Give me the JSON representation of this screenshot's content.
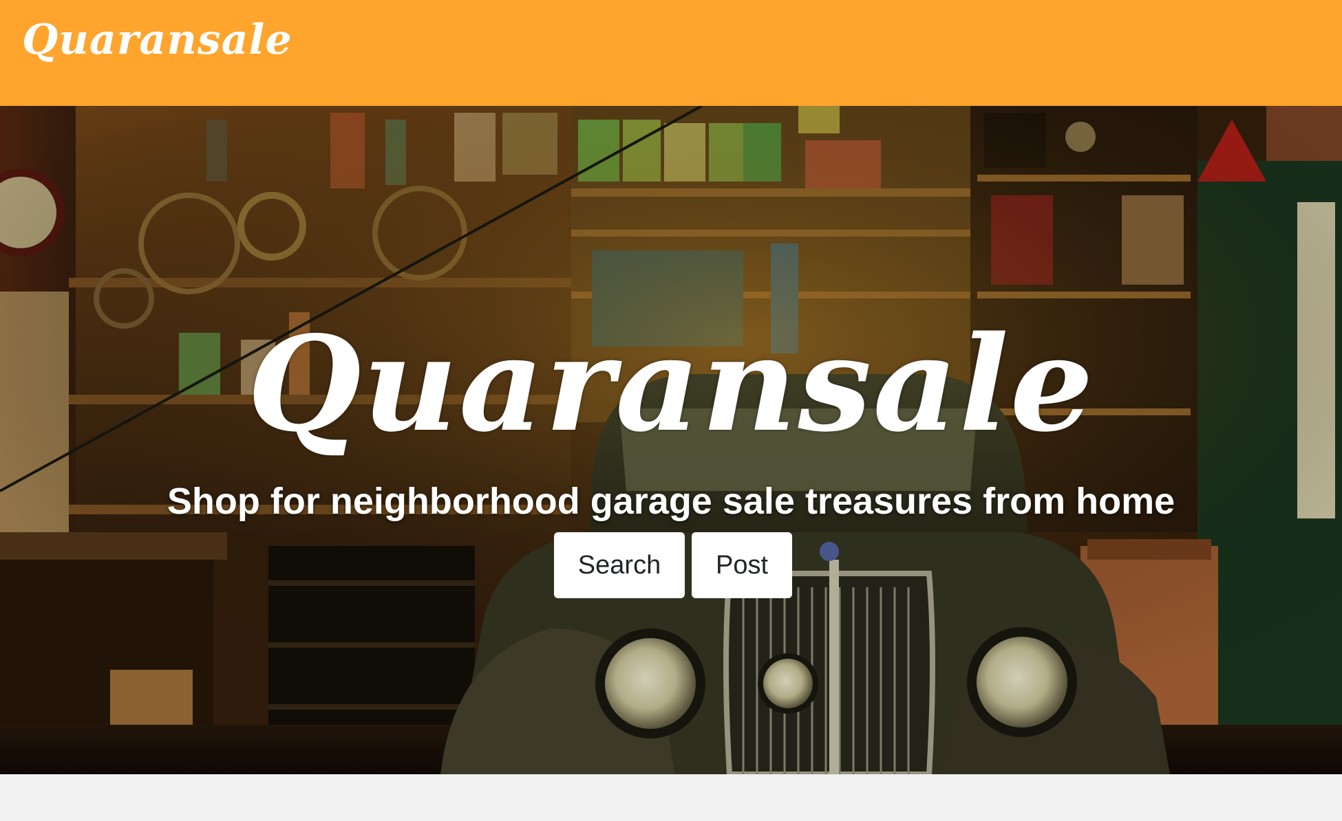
{
  "navbar": {
    "brand": "Quaransale",
    "background": "#ffa42d"
  },
  "hero": {
    "title": "Quaransale",
    "tagline": "Shop for neighborhood garage sale treasures from home",
    "buttons": {
      "search_label": "Search",
      "post_label": "Post"
    },
    "background_image": "garage-with-vintage-car"
  },
  "colors": {
    "accent": "#ffa42d",
    "button_bg": "#ffffff",
    "button_text": "#212529",
    "page_bg": "#f1f1f1"
  }
}
